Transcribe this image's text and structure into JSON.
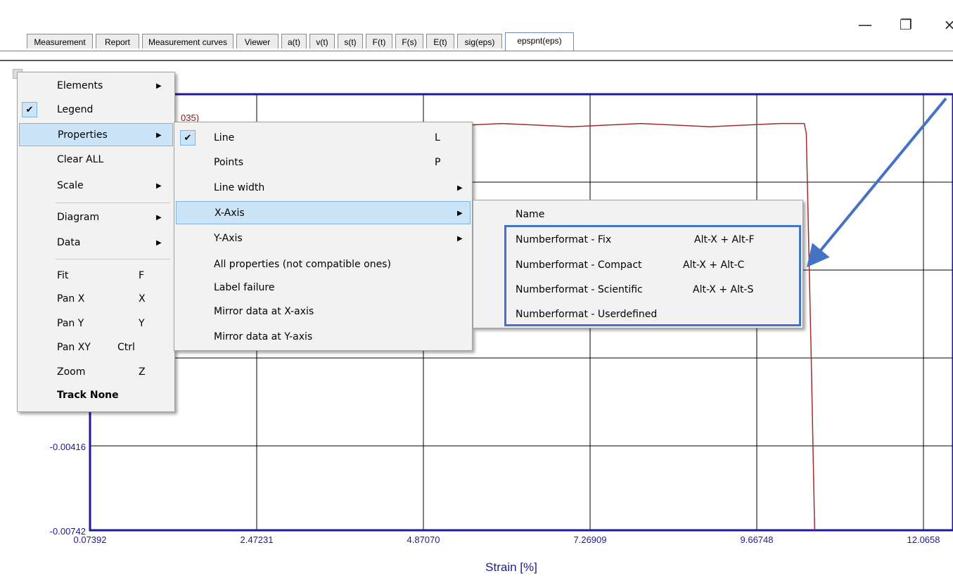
{
  "window_controls": {
    "minimize": "—",
    "restore": "❐",
    "close": "×"
  },
  "tabs": [
    {
      "label": "Measurement",
      "active": false
    },
    {
      "label": "Report",
      "active": false
    },
    {
      "label": "Measurement curves",
      "active": false
    },
    {
      "label": "Viewer",
      "active": false
    },
    {
      "label": "a(t)",
      "active": false
    },
    {
      "label": "v(t)",
      "active": false
    },
    {
      "label": "s(t)",
      "active": false
    },
    {
      "label": "F(t)",
      "active": false
    },
    {
      "label": "F(s)",
      "active": false
    },
    {
      "label": "E(t)",
      "active": false
    },
    {
      "label": "sig(eps)",
      "active": false
    },
    {
      "label": "epspnt(eps)",
      "active": true
    }
  ],
  "chart_data": {
    "type": "line",
    "xlabel": "Strain [%]",
    "ylabel": "",
    "x_ticks": [
      "0.07392",
      "2.47231",
      "4.87070",
      "7.26909",
      "9.66748",
      "12.0658"
    ],
    "y_ticks": [
      "-0.00416",
      "-0.00742"
    ],
    "xlim": [
      0.07392,
      12.0658
    ],
    "legend_fragment": "035)",
    "grid": true,
    "series": [
      {
        "color": "#a52a2a",
        "x": [
          1.0,
          2.0,
          3.0,
          4.0,
          5.0,
          6.0,
          7.0,
          8.0,
          9.0,
          10.0,
          10.35,
          10.38,
          10.45,
          10.5
        ],
        "y": [
          0.005,
          0.0051,
          0.005,
          0.0051,
          0.005,
          0.0051,
          0.005,
          0.0051,
          0.005,
          0.0051,
          0.0051,
          0.0048,
          -0.002,
          -0.00742
        ]
      }
    ]
  },
  "context_menu": {
    "items": [
      {
        "label": "Elements",
        "submenu": true
      },
      {
        "label": "Legend",
        "checked": true
      },
      {
        "label": "Properties",
        "submenu": true,
        "highlighted": true
      },
      {
        "label": "Clear ALL"
      },
      {
        "label": "Scale",
        "submenu": true
      },
      {
        "label": "Diagram",
        "submenu": true
      },
      {
        "label": "Data",
        "submenu": true
      },
      {
        "label": "Fit",
        "shortcut": "F"
      },
      {
        "label": "Pan X",
        "shortcut": "X"
      },
      {
        "label": "Pan Y",
        "shortcut": "Y"
      },
      {
        "label": "Pan XY",
        "shortcut": "Ctrl"
      },
      {
        "label": "Zoom",
        "shortcut": "Z"
      },
      {
        "label": "Track None",
        "bold": true
      }
    ]
  },
  "properties_menu": {
    "items": [
      {
        "label": "Line",
        "shortcut": "L",
        "checked": true
      },
      {
        "label": "Points",
        "shortcut": "P"
      },
      {
        "label": "Line width",
        "submenu": true
      },
      {
        "label": "X-Axis",
        "submenu": true,
        "highlighted": true
      },
      {
        "label": "Y-Axis",
        "submenu": true
      },
      {
        "label": "All properties (not compatible ones)"
      },
      {
        "label": "Label failure"
      },
      {
        "label": "Mirror data at X-axis"
      },
      {
        "label": "Mirror data at Y-axis"
      }
    ]
  },
  "xaxis_menu": {
    "items": [
      {
        "label": "Name"
      },
      {
        "label": "Numberformat - Fix",
        "shortcut": "Alt-X + Alt-F"
      },
      {
        "label": "Numberformat - Compact",
        "shortcut": "Alt-X + Alt-C"
      },
      {
        "label": "Numberformat - Scientific",
        "shortcut": "Alt-X + Alt-S"
      },
      {
        "label": "Numberformat - Userdefined"
      }
    ]
  },
  "colors": {
    "accent": "#4472c4",
    "axis": "#1a1a9a",
    "curve": "#a52a2a",
    "highlight": "#cce4f7"
  }
}
